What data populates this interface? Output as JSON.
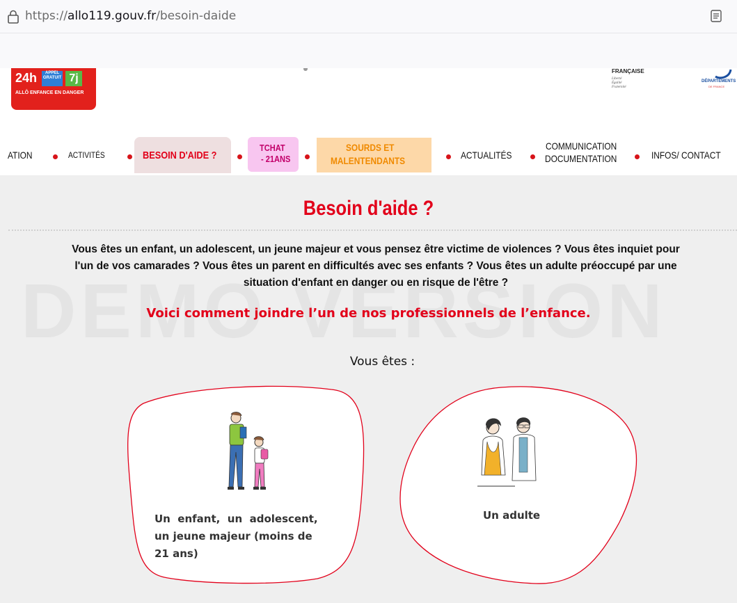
{
  "browser": {
    "url_scheme": "https://",
    "url_host": "allo119.gouv.fr",
    "url_path": "/besoin-daide"
  },
  "header": {
    "logo": {
      "hours": "24h",
      "appel": "APPEL",
      "gratuit": "GRATUIT",
      "days": "7j",
      "tagline": "ALLÔ ENFANCE EN DANGER"
    },
    "republique": {
      "title": "FRANÇAISE",
      "motto": [
        "Liberté",
        "Égalité",
        "Fraternité"
      ]
    },
    "departement": {
      "title": "DÉPARTEMENTS",
      "subtitle": "DE FRANCE"
    }
  },
  "nav": {
    "items": [
      "ATION",
      "ACTIVITÉS",
      "BESOIN D'AIDE ?",
      "TCHAT",
      "- 21ANS",
      "SOURDS ET",
      "MALENTENDANTS",
      "ACTUALITÉS",
      "COMMUNICATION",
      "DOCUMENTATION",
      "INFOS/ CONTACT"
    ]
  },
  "main": {
    "title": "Besoin d'aide ?",
    "intro_line1": "Vous êtes un enfant, un adolescent, un jeune majeur et vous pensez être victime de violences ? Vous êtes inquiet pour",
    "intro_line2": "l'un de vos camarades ? Vous êtes un parent en difficultés avec ses enfants ? Vous êtes un adulte préoccupé par une",
    "intro_line3": "situation d'enfant en danger ou en risque de l'être ?",
    "cta": "Voici comment joindre l’un de nos professionnels de l’enfance.",
    "vous_etes": "Vous êtes :",
    "watermark": "DEMO VERSION",
    "cards": [
      {
        "line1": "Un  enfant,  un  adolescent,",
        "line2": "un jeune majeur (moins de",
        "line3": "21 ans)"
      },
      {
        "line1": "Un adulte"
      }
    ]
  },
  "colors": {
    "accent_red": "#e2001a",
    "content_bg": "#efefef",
    "tab_besoin_bg": "#eedfe0",
    "tab_tchat_bg": "#f8c6f0",
    "tab_sourds_bg": "#fdd8a8"
  }
}
